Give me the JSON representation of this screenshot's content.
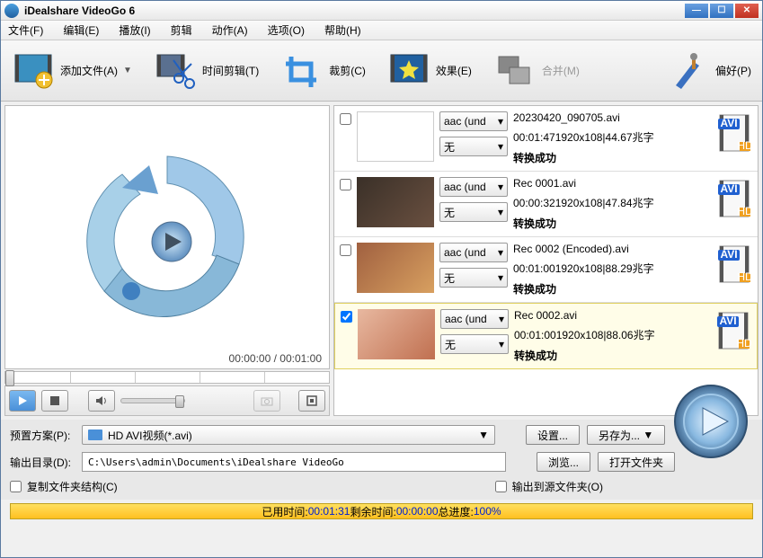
{
  "window": {
    "title": "iDealshare VideoGo 6"
  },
  "menu": {
    "file": "文件(F)",
    "edit": "编辑(E)",
    "play": "播放(I)",
    "trim": "剪辑",
    "action": "动作(A)",
    "option": "选项(O)",
    "help": "帮助(H)"
  },
  "toolbar": {
    "add": "添加文件(A)",
    "timecut": "时间剪辑(T)",
    "crop": "裁剪(C)",
    "effect": "效果(E)",
    "merge": "合并(M)",
    "pref": "偏好(P)"
  },
  "preview": {
    "time_current": "00:00:00",
    "time_sep": " / ",
    "time_total": "00:01:00"
  },
  "items": [
    {
      "checked": false,
      "codec_a": "aac (und",
      "codec_v": "无",
      "name": "20230420_090705.avi",
      "info": "00:01:471920x108|44.67兆字",
      "status": "转换成功",
      "format": "AVI"
    },
    {
      "checked": false,
      "codec_a": "aac (und",
      "codec_v": "无",
      "name": "Rec 0001.avi",
      "info": "00:00:321920x108|47.84兆字",
      "status": "转换成功",
      "format": "AVI"
    },
    {
      "checked": false,
      "codec_a": "aac (und",
      "codec_v": "无",
      "name": "Rec 0002 (Encoded).avi",
      "info": "00:01:001920x108|88.29兆字",
      "status": "转换成功",
      "format": "AVI"
    },
    {
      "checked": true,
      "codec_a": "aac (und",
      "codec_v": "无",
      "name": "Rec 0002.avi",
      "info": "00:01:001920x108|88.06兆字",
      "status": "转换成功",
      "format": "AVI"
    }
  ],
  "profile": {
    "label": "预置方案(P):",
    "value": "HD AVI视频(*.avi)",
    "settings": "设置...",
    "saveas": "另存为..."
  },
  "output": {
    "label": "输出目录(D):",
    "path": "C:\\Users\\admin\\Documents\\iDealshare VideoGo",
    "browse": "浏览...",
    "open": "打开文件夹"
  },
  "checks": {
    "copy_struct": "复制文件夹结构(C)",
    "out_to_src": "输出到源文件夹(O)"
  },
  "progress": {
    "elapsed_label": "已用时间: ",
    "elapsed": "00:01:31",
    "remain_label": " 剩余时间: ",
    "remain": "00:00:00",
    "total_label": " 总进度:",
    "total": "100%"
  }
}
